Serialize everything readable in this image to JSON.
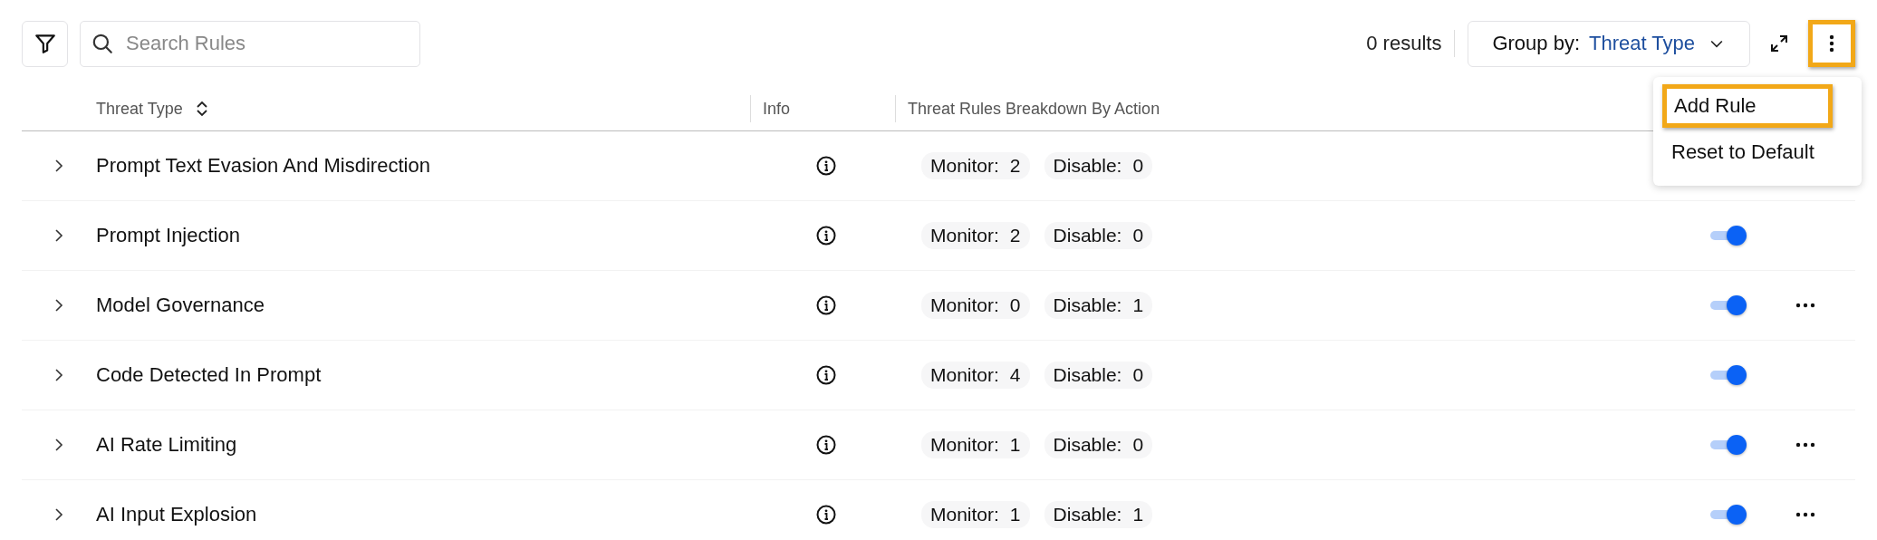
{
  "toolbar": {
    "search": {
      "placeholder": "Search Rules"
    },
    "results": "0 results",
    "group_by": {
      "label": "Group by:",
      "value": "Threat Type"
    },
    "more_button": {
      "highlighted": true
    }
  },
  "table": {
    "columns": [
      {
        "label": "Threat Type",
        "sortable": true
      },
      {
        "label": "Info",
        "sortable": false
      },
      {
        "label": "Threat Rules Breakdown By Action",
        "sortable": false
      }
    ],
    "rows": [
      {
        "name": "Prompt Text Evasion And Misdirection",
        "monitor_label": "Monitor:",
        "monitor": "2",
        "disable_label": "Disable:",
        "disable": "0",
        "more": false
      },
      {
        "name": "Prompt Injection",
        "monitor_label": "Monitor:",
        "monitor": "2",
        "disable_label": "Disable:",
        "disable": "0",
        "enabled": true,
        "more": false
      },
      {
        "name": "Model Governance",
        "monitor_label": "Monitor:",
        "monitor": "0",
        "disable_label": "Disable:",
        "disable": "1",
        "enabled": true,
        "more": true
      },
      {
        "name": "Code Detected In Prompt",
        "monitor_label": "Monitor:",
        "monitor": "4",
        "disable_label": "Disable:",
        "disable": "0",
        "enabled": true,
        "more": false
      },
      {
        "name": "AI Rate Limiting",
        "monitor_label": "Monitor:",
        "monitor": "1",
        "disable_label": "Disable:",
        "disable": "0",
        "enabled": true,
        "more": true
      },
      {
        "name": "AI Input Explosion",
        "monitor_label": "Monitor:",
        "monitor": "1",
        "disable_label": "Disable:",
        "disable": "1",
        "enabled": true,
        "more": true
      }
    ]
  },
  "menu": {
    "items": [
      {
        "label": "Add Rule",
        "highlighted": true
      },
      {
        "label": "Reset to Default",
        "highlighted": false
      }
    ]
  }
}
